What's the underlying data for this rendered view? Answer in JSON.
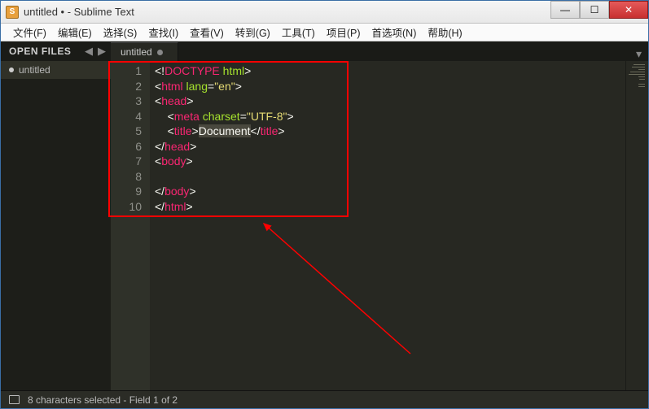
{
  "window": {
    "title": "untitled • - Sublime Text"
  },
  "menu": {
    "items": [
      "文件(F)",
      "编辑(E)",
      "选择(S)",
      "查找(I)",
      "查看(V)",
      "转到(G)",
      "工具(T)",
      "项目(P)",
      "首选项(N)",
      "帮助(H)"
    ]
  },
  "sidebar": {
    "header": "OPEN FILES",
    "file": "untitled"
  },
  "tab": {
    "label": "untitled"
  },
  "gutter": [
    "1",
    "2",
    "3",
    "4",
    "5",
    "6",
    "7",
    "8",
    "9",
    "10"
  ],
  "code": {
    "l1": {
      "a": "<!",
      "b": "DOCTYPE ",
      "c": "html",
      "d": ">"
    },
    "l2": {
      "a": "<",
      "b": "html ",
      "c": "lang",
      "d": "=",
      "e": "\"en\"",
      "f": ">"
    },
    "l3": {
      "a": "<",
      "b": "head",
      "c": ">"
    },
    "l4": {
      "pad": "    ",
      "a": "<",
      "b": "meta ",
      "c": "charset",
      "d": "=",
      "e": "\"UTF-8\"",
      "f": ">"
    },
    "l5": {
      "pad": "    ",
      "a": "<",
      "b": "title",
      "c": ">",
      "sel": "Document",
      "d": "</",
      "e": "title",
      "f": ">"
    },
    "l6": {
      "a": "</",
      "b": "head",
      "c": ">"
    },
    "l7": {
      "a": "<",
      "b": "body",
      "c": ">"
    },
    "l8": "",
    "l9": {
      "a": "</",
      "b": "body",
      "c": ">"
    },
    "l10": {
      "a": "</",
      "b": "html",
      "c": ">"
    }
  },
  "status": {
    "text": "8 characters selected - Field 1 of 2"
  }
}
